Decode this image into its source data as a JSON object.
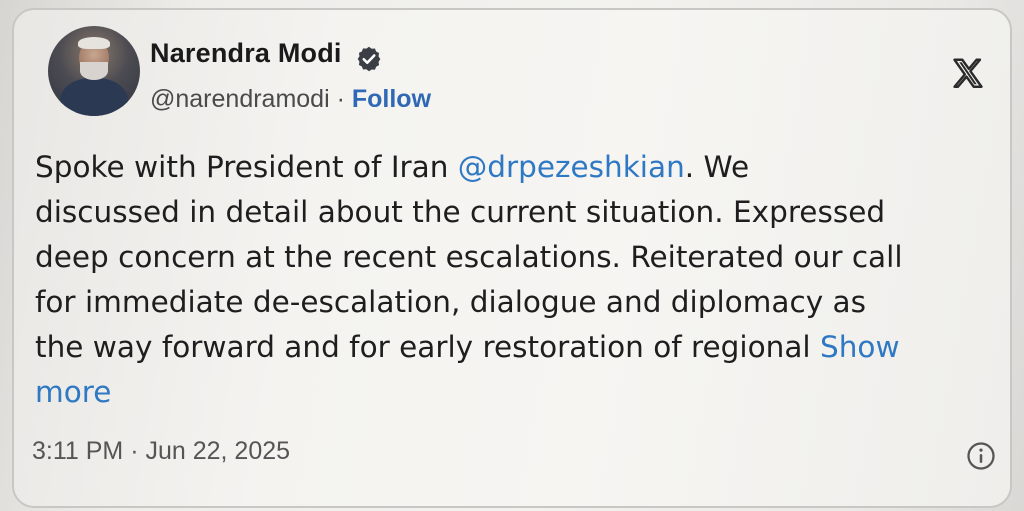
{
  "author": {
    "name": "Narendra Modi",
    "handle": "@narendramodi",
    "separator": " · ",
    "follow_label": "Follow",
    "verified_icon": "verified-badge-icon",
    "avatar": "profile-photo"
  },
  "platform_icon": "x-logo-icon",
  "tweet": {
    "line1_pre": "Spoke with President of Iran ",
    "mention": "@drpezeshkian",
    "line1_post": ". We",
    "line2": "discussed in detail about the current situation. Expressed",
    "line3": "deep concern at the recent escalations. Reiterated our call",
    "line4": "for immediate de-escalation, dialogue and diplomacy as",
    "line5": "the way forward and for early restoration of regional ",
    "show_more_1": "Show",
    "show_more_2": "more"
  },
  "timestamp": "3:11 PM · Jun 22, 2025",
  "info_icon": "info-icon",
  "colors": {
    "link": "#2f78c4",
    "follow": "#2f68b4",
    "text": "#1e1e1e",
    "muted": "#555555"
  }
}
